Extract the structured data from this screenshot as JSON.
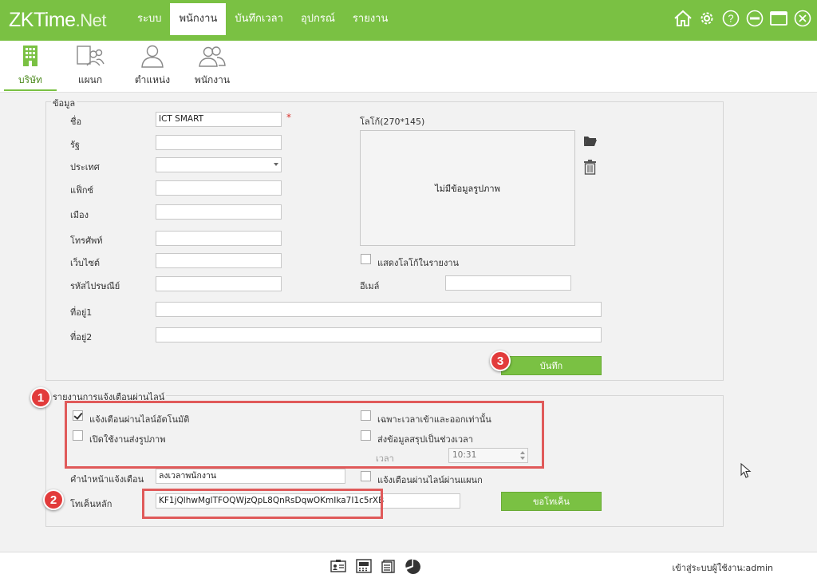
{
  "app": {
    "logo_main": "ZKTime",
    "logo_suffix": ".Net"
  },
  "nav": {
    "items": [
      {
        "label": "ระบบ",
        "active": false
      },
      {
        "label": "พนักงาน",
        "active": true
      },
      {
        "label": "บันทึกเวลา",
        "active": false
      },
      {
        "label": "อุปกรณ์",
        "active": false
      },
      {
        "label": "รายงาน",
        "active": false
      }
    ]
  },
  "window_icons": [
    "home-icon",
    "gear-icon",
    "help-icon",
    "minimize-icon",
    "maximize-icon",
    "close-icon"
  ],
  "subnav": {
    "items": [
      {
        "label": "บริษัท",
        "icon": "building-icon",
        "active": true
      },
      {
        "label": "แผนก",
        "icon": "department-icon",
        "active": false
      },
      {
        "label": "ตำแหน่ง",
        "icon": "position-icon",
        "active": false
      },
      {
        "label": "พนักงาน",
        "icon": "employees-icon",
        "active": false
      }
    ]
  },
  "info": {
    "title": "ข้อมูล",
    "name_label": "ชื่อ",
    "name_value": "ICT SMART",
    "required_mark": "*",
    "state_label": "รัฐ",
    "country_label": "ประเทศ",
    "fax_label": "แฟ็กซ์",
    "city_label": "เมือง",
    "phone_label": "โทรศัพท์",
    "website_label": "เว็บไซต์",
    "postcode_label": "รหัสไปรษณีย์",
    "email_label": "อีเมล์",
    "address1_label": "ที่อยู่1",
    "address2_label": "ที่อยู่2",
    "logo_label": "โลโก้(270*145)",
    "no_image_text": "ไม่มีข้อมูลรูปภาพ",
    "show_logo_label": "แสดงโลโก้ในรายงาน",
    "show_logo_checked": false,
    "save_button": "บันทึก"
  },
  "line_notify": {
    "title": "รายงานการแจ้งเตือนผ่านไลน์",
    "auto_notify_label": "แจ้งเตือนผ่านไลน์อัตโนมัติ",
    "auto_notify_checked": true,
    "enable_image_label": "เปิดใช้งานส่งรูปภาพ",
    "enable_image_checked": false,
    "inout_only_label": "เฉพาะเวลาเข้าและออกเท่านั้น",
    "inout_only_checked": false,
    "send_summary_label": "ส่งข้อมูลสรุปเป็นช่วงเวลา",
    "send_summary_checked": false,
    "time_label": "เวลา",
    "time_value": "10:31",
    "prefix_label": "คำนำหน้าแจ้งเตือน",
    "prefix_value": "ลงเวลาพนักงาน",
    "dept_notify_label": "แจ้งเตือนผ่านไลน์ผ่านแผนก",
    "dept_notify_checked": false,
    "token_label": "โทเค็นหลัก",
    "token_value": "KF1jQlhwMglTFOQWjzQpL8QnRsDqwOKmIka7I1c5rXB",
    "token_button": "ขอโทเค็น"
  },
  "annotations": {
    "badge_1": "1",
    "badge_2": "2",
    "badge_3": "3",
    "badge_color": "#e23b3b"
  },
  "status": {
    "login_text": "เข้าสู่ระบบผู้ใช้งาน:admin",
    "icons": [
      "id-card-icon",
      "device-icon",
      "report-icon",
      "pie-chart-icon"
    ]
  },
  "colors": {
    "accent": "#7ac143",
    "highlight": "#e05a5a"
  }
}
